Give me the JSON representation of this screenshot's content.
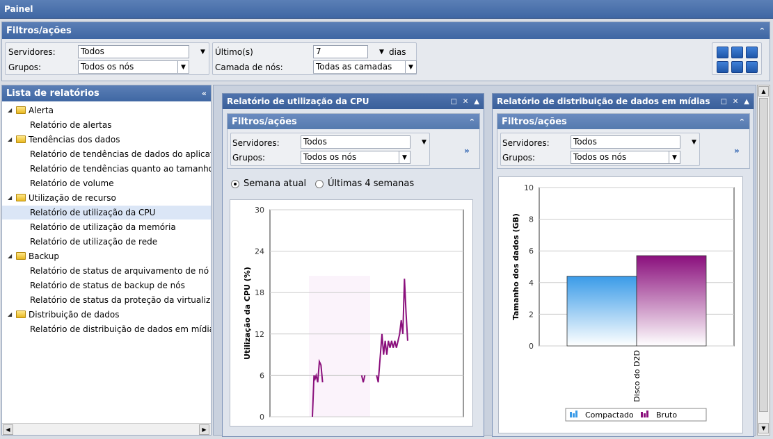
{
  "app": {
    "title": "Painel"
  },
  "filters": {
    "title": "Filtros/ações",
    "servers_label": "Servidores:",
    "servers_value": "Todos",
    "groups_label": "Grupos:",
    "groups_value": "Todos os nós",
    "last_label": "Último(s)",
    "last_value": "7",
    "last_unit": "dias",
    "layer_label": "Camada de nós:",
    "layer_value": "Todas as camadas"
  },
  "sidebar": {
    "title": "Lista de relatórios",
    "groups": [
      {
        "label": "Alerta",
        "items": [
          "Relatório de alertas"
        ]
      },
      {
        "label": "Tendências dos dados",
        "items": [
          "Relatório de tendências de dados do aplicativo",
          "Relatório de tendências quanto ao tamanho do",
          "Relatório de volume"
        ]
      },
      {
        "label": "Utilização de recurso",
        "items": [
          "Relatório de utilização da CPU",
          "Relatório de utilização da memória",
          "Relatório de utilização de rede"
        ]
      },
      {
        "label": "Backup",
        "items": [
          "Relatório de status de arquivamento de nó",
          "Relatório de status de backup de nós",
          "Relatório de status da proteção da virtualização"
        ]
      },
      {
        "label": "Distribuição de dados",
        "items": [
          "Relatório de distribuição de dados em mídias"
        ]
      }
    ],
    "selected": "Relatório de utilização da CPU"
  },
  "cpu_report": {
    "title": "Relatório de utilização da CPU",
    "filters_title": "Filtros/ações",
    "servers_label": "Servidores:",
    "servers_value": "Todos",
    "groups_label": "Grupos:",
    "groups_value": "Todos os nós",
    "radio_current": "Semana atual",
    "radio_last4": "Últimas 4 semanas"
  },
  "dist_report": {
    "title": "Relatório de distribuição de dados em mídias",
    "filters_title": "Filtros/ações",
    "servers_label": "Servidores:",
    "servers_value": "Todos",
    "groups_label": "Grupos:",
    "groups_value": "Todos os nós"
  },
  "chart_data": [
    {
      "type": "line",
      "ylabel": "Utilização da CPU (%)",
      "ylim": [
        0,
        30
      ],
      "yticks": [
        "30",
        "24",
        "18",
        "12",
        "6",
        "0"
      ],
      "grid": true,
      "series": [
        {
          "values": [
            [
              0,
              0
            ],
            [
              0.3,
              6
            ],
            [
              0.5,
              5.5
            ],
            [
              0.7,
              6
            ],
            [
              1,
              5
            ],
            [
              1.3,
              8
            ],
            [
              1.6,
              7.5
            ],
            [
              1.9,
              5
            ],
            [
              12,
              6
            ],
            [
              12.3,
              5
            ],
            [
              13,
              12
            ],
            [
              13.3,
              9
            ],
            [
              13.6,
              11
            ],
            [
              13.9,
              9
            ],
            [
              14.2,
              11
            ],
            [
              14.5,
              10
            ],
            [
              14.8,
              11
            ],
            [
              15.1,
              10
            ],
            [
              15.4,
              11
            ],
            [
              15.7,
              10
            ],
            [
              16,
              11
            ],
            [
              16.3,
              12
            ],
            [
              16.6,
              14
            ],
            [
              16.9,
              12
            ],
            [
              17.2,
              20
            ],
            [
              17.5,
              15
            ],
            [
              17.8,
              11
            ]
          ],
          "color": "#8a0f7c"
        }
      ]
    },
    {
      "type": "bar",
      "ylabel": "Tamanho dos dados (GB)",
      "ylim": [
        0,
        10
      ],
      "yticks": [
        "10",
        "8",
        "6",
        "4",
        "2",
        "0"
      ],
      "categories": [
        "Disco do D2D"
      ],
      "series": [
        {
          "name": "Compactado",
          "values": [
            4.4
          ],
          "color": "#3a9be8"
        },
        {
          "name": "Bruto",
          "values": [
            5.7
          ],
          "color": "#8a0f7c"
        }
      ],
      "legend": "bottom"
    }
  ]
}
